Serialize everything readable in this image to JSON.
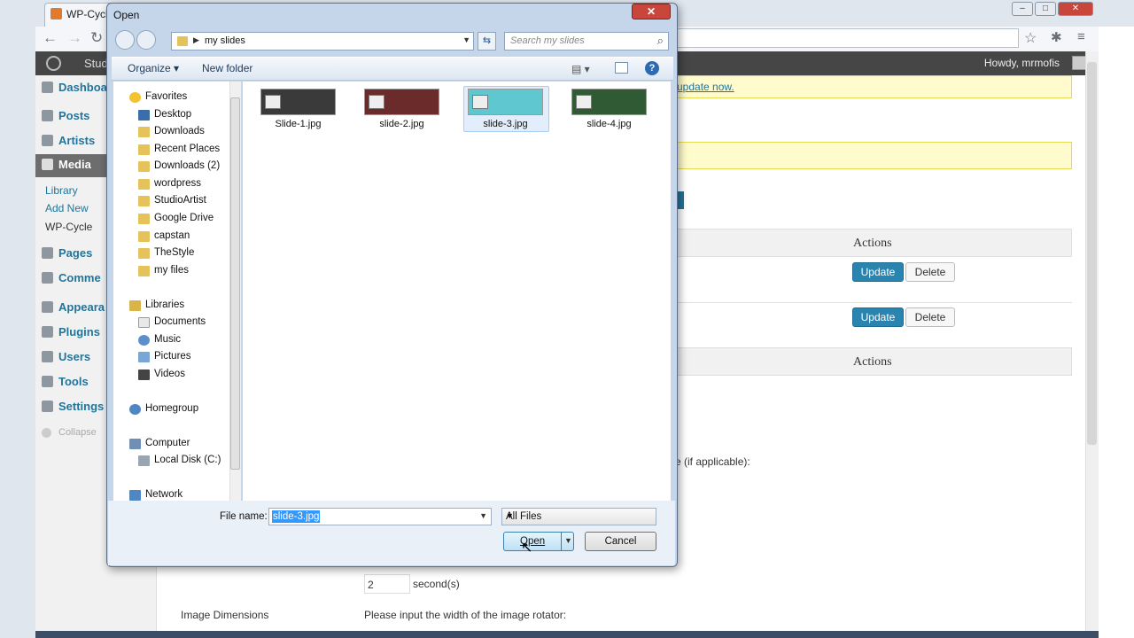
{
  "browser": {
    "tab_title": "WP-Cycle",
    "window_buttons": [
      "–",
      "□",
      "✕"
    ]
  },
  "wp": {
    "admin_bar": {
      "site_name": "Stud",
      "greeting": "Howdy, mrmofis"
    },
    "sidebar": {
      "items": [
        {
          "label": "Dashboa"
        },
        {
          "label": "Posts"
        },
        {
          "label": "Artists"
        },
        {
          "label": "Media"
        },
        {
          "label": "Pages"
        },
        {
          "label": "Comme"
        },
        {
          "label": "Appeara"
        },
        {
          "label": "Plugins"
        },
        {
          "label": "Users"
        },
        {
          "label": "Tools"
        },
        {
          "label": "Settings"
        },
        {
          "label": "Collapse"
        }
      ],
      "media_sub": [
        "Library",
        "Add New",
        "WP-Cycle"
      ]
    },
    "notice_link": "update now.",
    "table": {
      "actions_header": "Actions",
      "update_label": "Update",
      "delete_label": "Delete"
    },
    "applicable_text": "e (if applicable):",
    "interval_value": "2",
    "seconds_label": "second(s)",
    "image_dimensions_label": "Image Dimensions",
    "width_prompt": "Please input the width of the image rotator:"
  },
  "dialog": {
    "title": "Open",
    "close": "✕",
    "address_path": "my slides",
    "search_placeholder": "Search my slides",
    "organize": "Organize ▾",
    "new_folder": "New folder",
    "help": "?",
    "nav": {
      "favorites": "Favorites",
      "favorites_items": [
        "Desktop",
        "Downloads",
        "Recent Places",
        "Downloads (2)",
        "wordpress",
        "StudioArtist",
        "Google Drive",
        "capstan",
        "TheStyle",
        "my files"
      ],
      "libraries": "Libraries",
      "libraries_items": [
        "Documents",
        "Music",
        "Pictures",
        "Videos"
      ],
      "homegroup": "Homegroup",
      "computer": "Computer",
      "computer_items": [
        "Local Disk (C:)"
      ],
      "network": "Network"
    },
    "files": [
      {
        "name": "Slide-1.jpg",
        "color": "#3a3a3a"
      },
      {
        "name": "slide-2.jpg",
        "color": "#6b2b2b"
      },
      {
        "name": "slide-3.jpg",
        "color": "#5fc7cf"
      },
      {
        "name": "slide-4.jpg",
        "color": "#2f5a34"
      }
    ],
    "selected_file": "slide-3.jpg",
    "file_name_label": "File name:",
    "file_name_value": "slide-3.jpg",
    "filter": "All Files",
    "open_label": "Open",
    "cancel_label": "Cancel"
  }
}
